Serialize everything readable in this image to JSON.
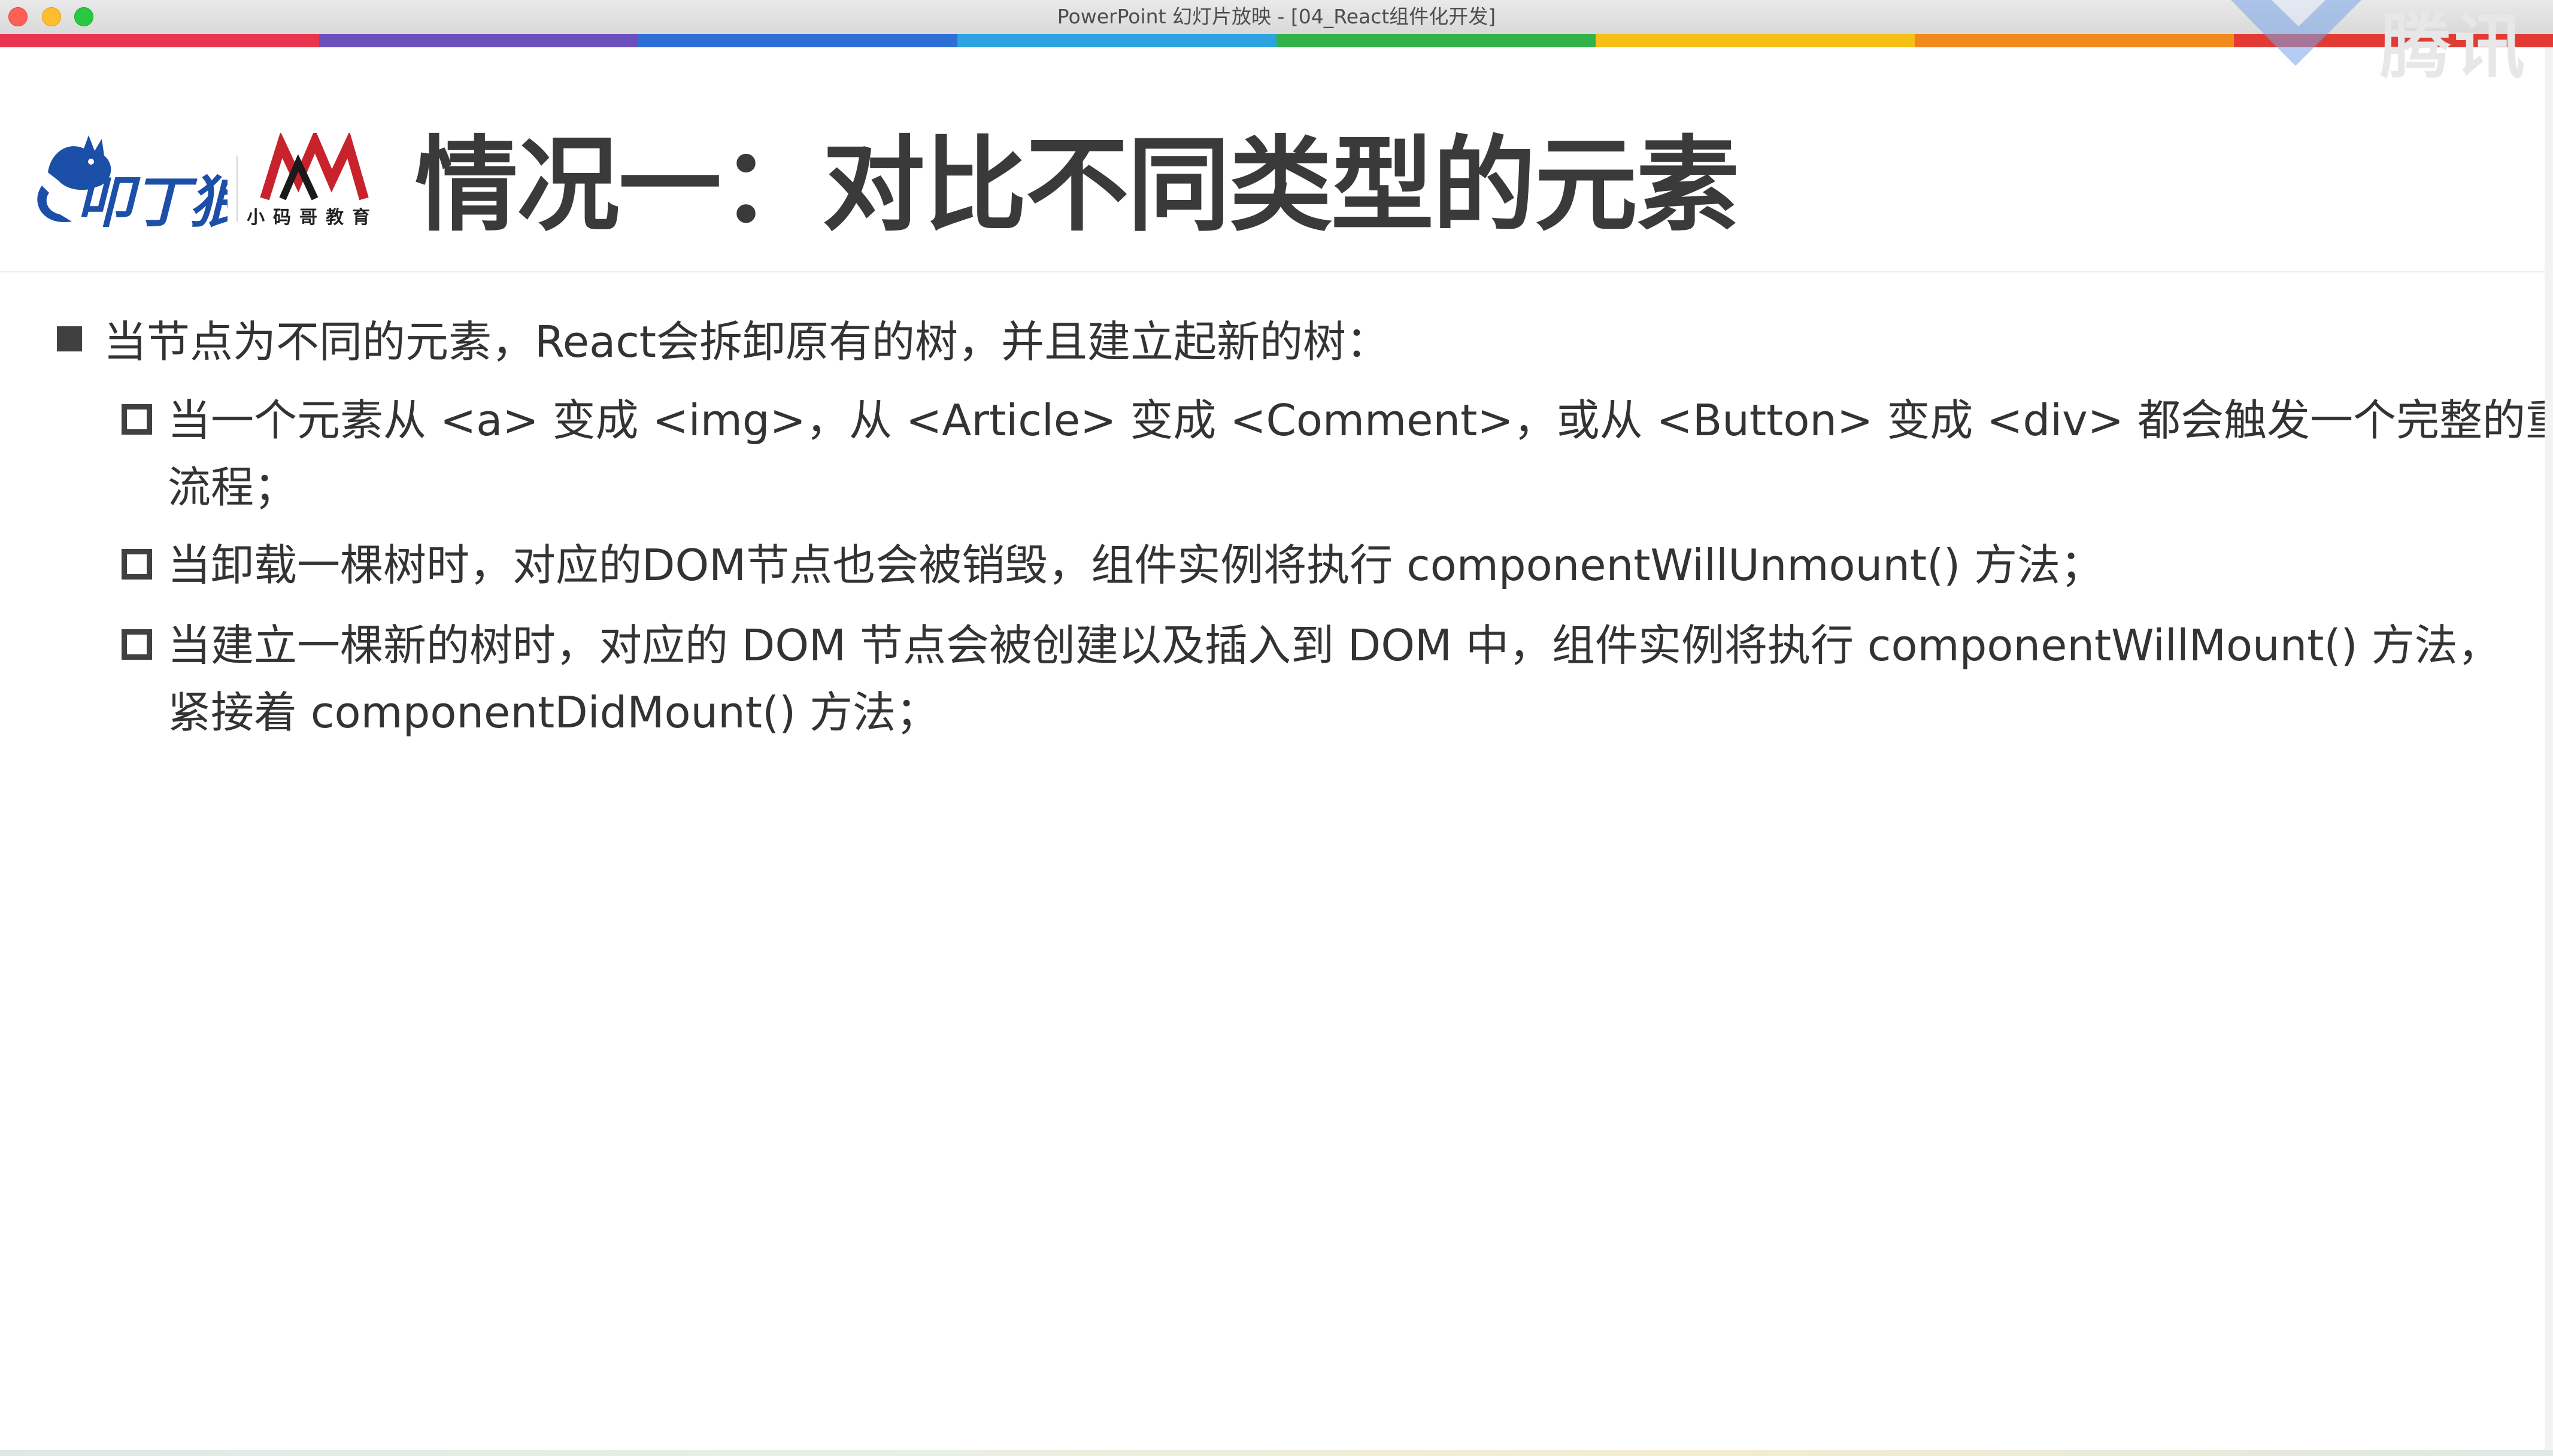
{
  "window": {
    "title": "PowerPoint 幻灯片放映 - [04_React组件化开发]"
  },
  "stripe_colors": [
    "#e8344e",
    "#6b4fbb",
    "#2d6fd6",
    "#2aa3e0",
    "#33b24a",
    "#f5c116",
    "#f08a1c",
    "#e23b34"
  ],
  "watermark": {
    "text": "腾讯"
  },
  "logos": {
    "left_logo": "wolf-logo",
    "right_logo_text": "小码哥教育"
  },
  "slide": {
    "title": "情况一：对比不同类型的元素",
    "bullet": "当节点为不同的元素，React会拆卸原有的树，并且建立起新的树：",
    "sub_items": [
      {
        "line1": "当一个元素从 <a> 变成 <img>，从 <Article> 变成 <Comment>，或从 <Button> 变成 <div> 都会触发一个完整的重建",
        "line2": "流程；"
      },
      {
        "line1": "当卸载一棵树时，对应的DOM节点也会被销毁，组件实例将执行 componentWillUnmount() 方法；"
      },
      {
        "line1": "当建立一棵新的树时，对应的 DOM 节点会被创建以及插入到 DOM 中，组件实例将执行 componentWillMount() 方法，",
        "line2": "紧接着 componentDidMount() 方法；"
      }
    ]
  },
  "colors": {
    "text": "#333333",
    "title": "#3a3a3a",
    "logo_blue": "#1c4fa8",
    "logo_red": "#c8232c"
  }
}
